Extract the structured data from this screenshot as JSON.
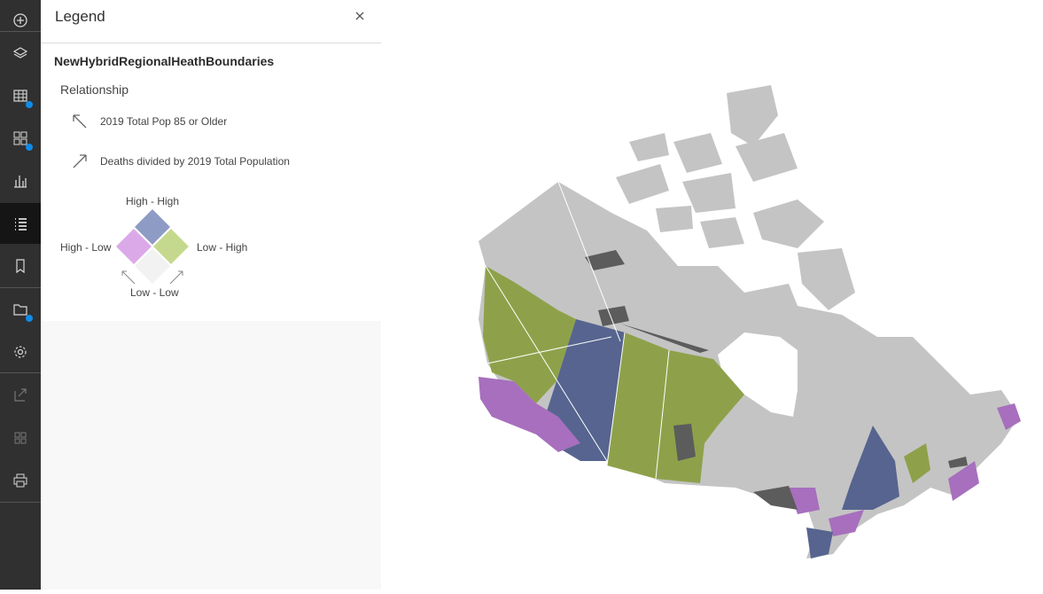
{
  "toolbar": {
    "items": [
      {
        "icon": "add-circle-icon"
      },
      {
        "icon": "layers-icon"
      },
      {
        "icon": "table-icon"
      },
      {
        "icon": "grid-widgets-icon"
      },
      {
        "icon": "chart-icon"
      },
      {
        "icon": "legend-list-icon"
      },
      {
        "icon": "bookmark-icon"
      },
      {
        "icon": "folder-icon"
      },
      {
        "icon": "gear-icon"
      },
      {
        "icon": "share-icon"
      },
      {
        "icon": "apps-grid-icon"
      },
      {
        "icon": "print-icon"
      }
    ],
    "accent": "#0f8be8"
  },
  "legend": {
    "title": "Legend",
    "layer_name": "NewHybridRegionalHeathBoundaries",
    "relationship_label": "Relationship",
    "field_1": "2019 Total Pop 85 or Older",
    "field_2": "Deaths divided by 2019 Total Population",
    "diamond": {
      "top": "High - High",
      "left": "High - Low",
      "right": "Low - High",
      "bottom": "Low - Low"
    },
    "colors": {
      "high_high": "#8e9bc5",
      "high_low": "#dba9e8",
      "low_high": "#c5d98e",
      "low_low": "#f2f2f2"
    }
  },
  "map": {
    "colors": {
      "base_land": "#c4c4c4",
      "dark_land": "#5c5c5c",
      "high_high": "#56648f",
      "high_low": "#a76fbd",
      "low_high": "#8ea14a"
    }
  }
}
